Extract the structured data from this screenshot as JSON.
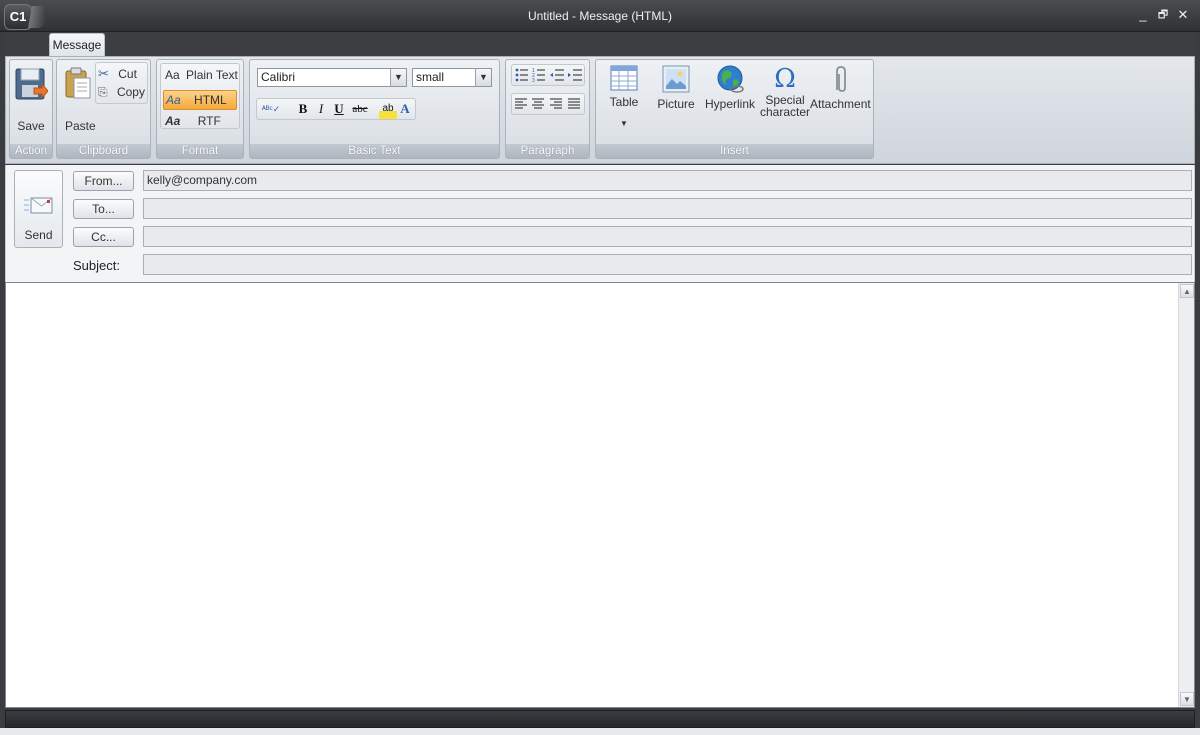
{
  "window": {
    "title": "Untitled - Message (HTML)",
    "logo_text": "C1",
    "controls": {
      "minimize": "_",
      "restore": "🗗",
      "close": "✕"
    }
  },
  "tabs": [
    {
      "label": "Message"
    }
  ],
  "ribbon": {
    "action": {
      "label": "Action",
      "save": "Save"
    },
    "clipboard": {
      "label": "Clipboard",
      "paste": "Paste",
      "cut": "Cut",
      "copy": "Copy"
    },
    "format": {
      "label": "Format",
      "plain_text": "Plain Text",
      "html": "HTML",
      "rtf": "RTF",
      "selected": "HTML"
    },
    "basic_text": {
      "label": "Basic Text",
      "font": "Calibri",
      "size": "small",
      "bold": "B",
      "italic": "I",
      "underline": "U",
      "strike": "abc",
      "font_color": "A"
    },
    "paragraph": {
      "label": "Paragraph"
    },
    "insert": {
      "label": "Insert",
      "table": "Table",
      "picture": "Picture",
      "hyperlink": "Hyperlink",
      "special_line1": "Special",
      "special_line2": "character",
      "attachment": "Attachment"
    }
  },
  "header": {
    "send": "Send",
    "from_label": "From...",
    "from_value": "kelly@company.com",
    "to_label": "To...",
    "to_value": "",
    "cc_label": "Cc...",
    "cc_value": "",
    "subject_label": "Subject:",
    "subject_value": ""
  },
  "colors": {
    "titlebar": "#2f3134",
    "ribbon": "#d8dde3",
    "html_selected": "#f7b24a",
    "editor": "#ffffff"
  }
}
